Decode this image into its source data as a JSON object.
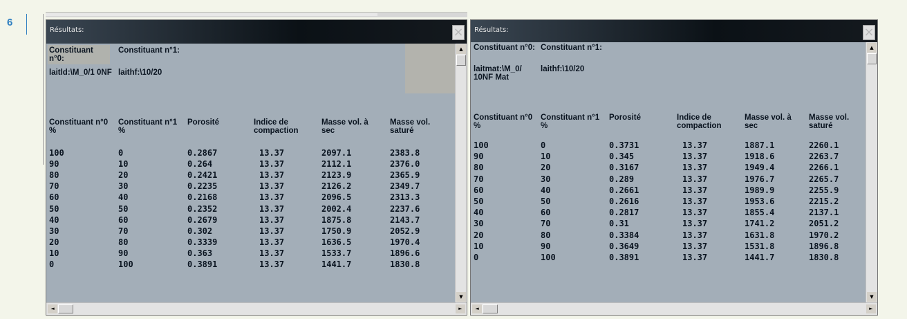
{
  "figure_number": "6",
  "windows": [
    {
      "title": "Résultats:",
      "close_glyph": "×",
      "constituents": [
        {
          "header": "Constituant n°0:",
          "value": "laitld:\\M_0/1 0NF"
        },
        {
          "header": "Constituant n°1:",
          "value": "laithf:\\10/20"
        }
      ],
      "columns": [
        "Constituant n°0  %",
        "Constituant n°1   %",
        "Porosité",
        "Indice de compaction",
        "Masse vol. à sec",
        "Masse vol. saturé"
      ],
      "rows": [
        [
          "100",
          "0",
          "0.2867",
          "13.37",
          "2097.1",
          "2383.8"
        ],
        [
          "90",
          "10",
          "0.264",
          "13.37",
          "2112.1",
          "2376.0"
        ],
        [
          "80",
          "20",
          "0.2421",
          "13.37",
          "2123.9",
          "2365.9"
        ],
        [
          "70",
          "30",
          "0.2235",
          "13.37",
          "2126.2",
          "2349.7"
        ],
        [
          "60",
          "40",
          "0.2168",
          "13.37",
          "2096.5",
          "2313.3"
        ],
        [
          "50",
          "50",
          "0.2352",
          "13.37",
          "2002.4",
          "2237.6"
        ],
        [
          "40",
          "60",
          "0.2679",
          "13.37",
          "1875.8",
          "2143.7"
        ],
        [
          "30",
          "70",
          "0.302",
          "13.37",
          "1750.9",
          "2052.9"
        ],
        [
          "20",
          "80",
          "0.3339",
          "13.37",
          "1636.5",
          "1970.4"
        ],
        [
          "10",
          "90",
          "0.363",
          "13.37",
          "1533.7",
          "1896.6"
        ],
        [
          "0",
          "100",
          "0.3891",
          "13.37",
          "1441.7",
          "1830.8"
        ]
      ]
    },
    {
      "title": "Résultats:",
      "close_glyph": "×",
      "constituents": [
        {
          "header": "Constituant n°0:",
          "value": "laitmat:\\M_0/ 10NF Mat"
        },
        {
          "header": "Constituant n°1:",
          "value": "laithf:\\10/20"
        }
      ],
      "columns": [
        "Constituant n°0  %",
        "Constituant n°1   %",
        "Porosité",
        "Indice de compaction",
        "Masse vol. à sec",
        "Masse vol. saturé"
      ],
      "rows": [
        [
          "100",
          "0",
          "0.3731",
          "13.37",
          "1887.1",
          "2260.1"
        ],
        [
          "90",
          "10",
          "0.345",
          "13.37",
          "1918.6",
          "2263.7"
        ],
        [
          "80",
          "20",
          "0.3167",
          "13.37",
          "1949.4",
          "2266.1"
        ],
        [
          "70",
          "30",
          "0.289",
          "13.37",
          "1976.7",
          "2265.7"
        ],
        [
          "60",
          "40",
          "0.2661",
          "13.37",
          "1989.9",
          "2255.9"
        ],
        [
          "50",
          "50",
          "0.2616",
          "13.37",
          "1953.6",
          "2215.2"
        ],
        [
          "40",
          "60",
          "0.2817",
          "13.37",
          "1855.4",
          "2137.1"
        ],
        [
          "30",
          "70",
          "0.31",
          "13.37",
          "1741.2",
          "2051.2"
        ],
        [
          "20",
          "80",
          "0.3384",
          "13.37",
          "1631.8",
          "1970.2"
        ],
        [
          "10",
          "90",
          "0.3649",
          "13.37",
          "1531.8",
          "1896.8"
        ],
        [
          "0",
          "100",
          "0.3891",
          "13.37",
          "1441.7",
          "1830.8"
        ]
      ]
    }
  ]
}
